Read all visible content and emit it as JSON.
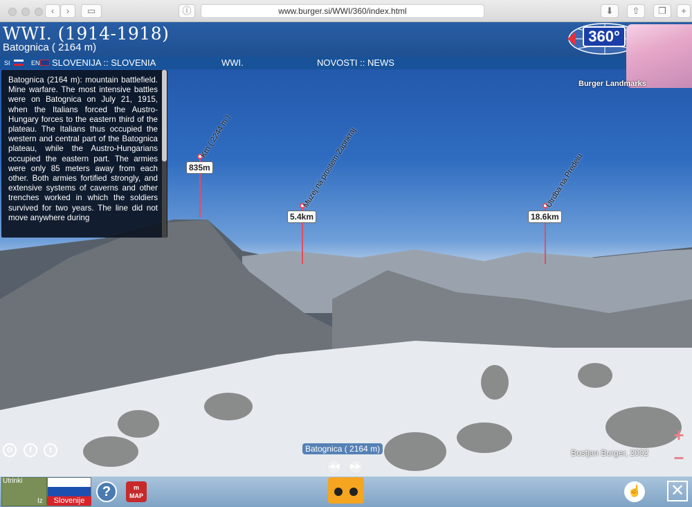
{
  "browser": {
    "url": "www.burger.si/WWI/360/index.html"
  },
  "header": {
    "title": "WWI. (1914-1918)",
    "subtitle": "Batognica ( 2164 m)",
    "brand": "Burger Landmarks"
  },
  "nav": {
    "si": "SI",
    "en": "EN",
    "slovenia": "SLOVENIJA :: SLOVENIA",
    "wwi": "WWI.",
    "news": "NOVOSTI :: NEWS"
  },
  "description": "Batognica (2164 m): mountain battlefield. Mine warfare. The most intensive battles were on Batognica on July 21, 1915, when the Italians forced the Austro-Hungary forces to the eastern third of the plateau. The Italians thus occupied the western and central part of the Batognica plateau, while the Austro-Hungarians occupied the eastern part. The armies were only 85 meters away from each other. Both armies fortified strongly, and extensive systems of caverns and other trenches worked in which the soldiers survived for two years. The line did not move anywhere during",
  "pins": [
    {
      "label": "Krn ( 2244 m )",
      "dist": "835m"
    },
    {
      "label": "Muzej na prostem Zaprikraj",
      "dist": "5.4km"
    },
    {
      "label": "Utrdba na Predelu",
      "dist": "18.6km"
    }
  ],
  "logo": "360°",
  "caption": "Batognica ( 2164 m)",
  "credit": "Bostjan Burger, 2002",
  "bottom": {
    "map_label": "Utrinki",
    "iz": "Iz",
    "country": "Slovenije",
    "help": "?",
    "map_btn": "MAP"
  }
}
